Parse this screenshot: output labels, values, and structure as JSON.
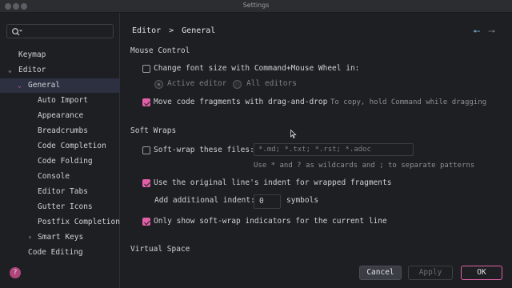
{
  "window": {
    "title": "Settings"
  },
  "search": {
    "placeholder": ""
  },
  "sidebar": {
    "items": [
      {
        "label": "Keymap"
      },
      {
        "label": "Editor"
      },
      {
        "label": "General"
      },
      {
        "label": "Auto Import"
      },
      {
        "label": "Appearance"
      },
      {
        "label": "Breadcrumbs"
      },
      {
        "label": "Code Completion"
      },
      {
        "label": "Code Folding"
      },
      {
        "label": "Console"
      },
      {
        "label": "Editor Tabs"
      },
      {
        "label": "Gutter Icons"
      },
      {
        "label": "Postfix Completion"
      },
      {
        "label": "Smart Keys"
      },
      {
        "label": "Code Editing"
      }
    ]
  },
  "breadcrumb": {
    "parent": "Editor",
    "separator": ">",
    "current": "General"
  },
  "mouse_control": {
    "header": "Mouse Control",
    "change_font_label": "Change font size with Command+Mouse Wheel in:",
    "change_font_checked": false,
    "active_editor_label": "Active editor",
    "all_editors_label": "All editors",
    "selected_scope": "Active editor",
    "drag_drop_label": "Move code fragments with drag-and-drop",
    "drag_drop_checked": true,
    "drag_drop_hint": "To copy, hold Command while dragging"
  },
  "soft_wraps": {
    "header": "Soft Wraps",
    "wrap_files_label": "Soft-wrap these files:",
    "wrap_files_checked": false,
    "patterns_value": "*.md; *.txt; *.rst; *.adoc",
    "patterns_hint": "Use * and ? as wildcards and ; to separate patterns",
    "use_indent_label": "Use the original line's indent for wrapped fragments",
    "use_indent_checked": true,
    "additional_indent_label": "Add additional indent:",
    "additional_indent_value": "0",
    "additional_indent_unit": "symbols",
    "show_indicators_label": "Only show soft-wrap indicators for the current line",
    "show_indicators_checked": true
  },
  "virtual_space": {
    "header": "Virtual Space"
  },
  "buttons": {
    "cancel": "Cancel",
    "apply": "Apply",
    "ok": "OK",
    "help": "?"
  },
  "colors": {
    "accent": "#e05fa6",
    "background": "#1e1f22",
    "selection": "#2c3040"
  }
}
